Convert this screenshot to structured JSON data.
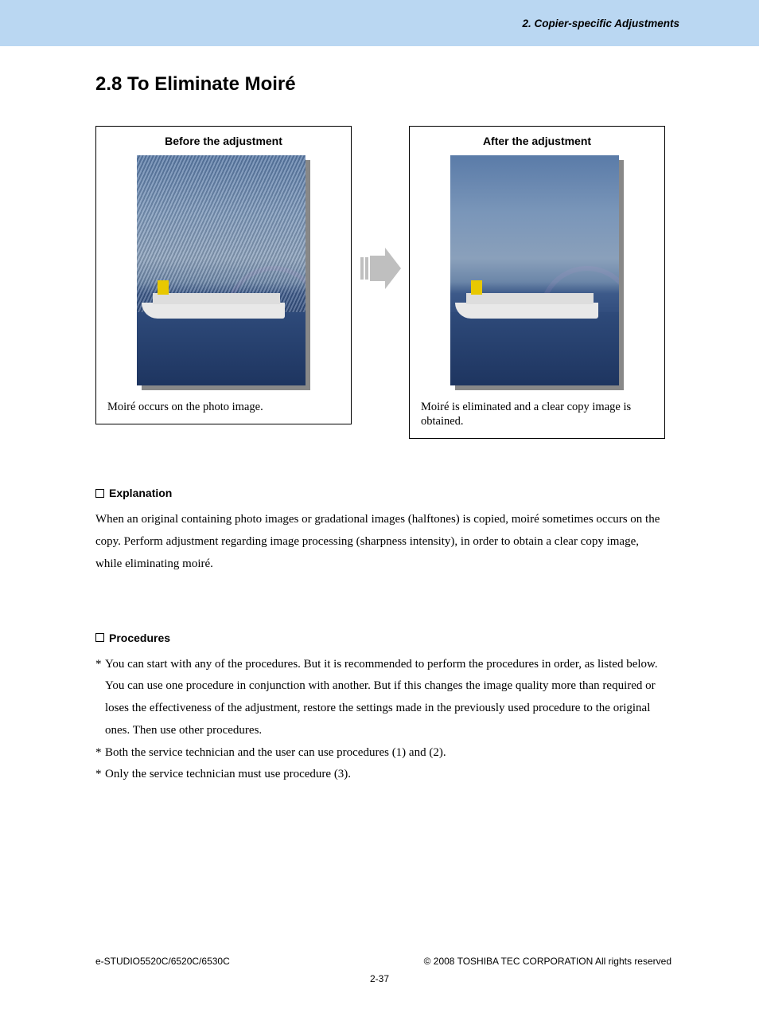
{
  "header": {
    "chapter": "2. Copier-specific Adjustments"
  },
  "title": "2.8 To Eliminate Moiré",
  "before": {
    "heading": "Before the adjustment",
    "caption": "Moiré occurs on the photo image."
  },
  "after": {
    "heading": "After the adjustment",
    "caption": "Moiré is eliminated and a clear copy image is obtained."
  },
  "explanation": {
    "heading": "Explanation",
    "body": "When an original containing photo images or gradational images (halftones) is copied, moiré sometimes occurs on the copy.  Perform adjustment regarding image processing (sharpness intensity), in order to obtain a clear copy image, while eliminating moiré."
  },
  "procedures": {
    "heading": "Procedures",
    "notes": [
      "You can start with any of the procedures.  But it is recommended to perform the procedures in order, as listed below.  You can use one procedure in conjunction with another.  But if this changes the image quality more than required or loses the effectiveness of the adjustment, restore the settings made in the previously used procedure to the original ones.  Then use other procedures.",
      "Both the service technician and the user can use procedures (1) and (2).",
      "Only the service technician must use procedure (3)."
    ]
  },
  "footer": {
    "left": "e-STUDIO5520C/6520C/6530C",
    "right": "© 2008 TOSHIBA TEC CORPORATION All rights reserved",
    "page": "2-37"
  }
}
